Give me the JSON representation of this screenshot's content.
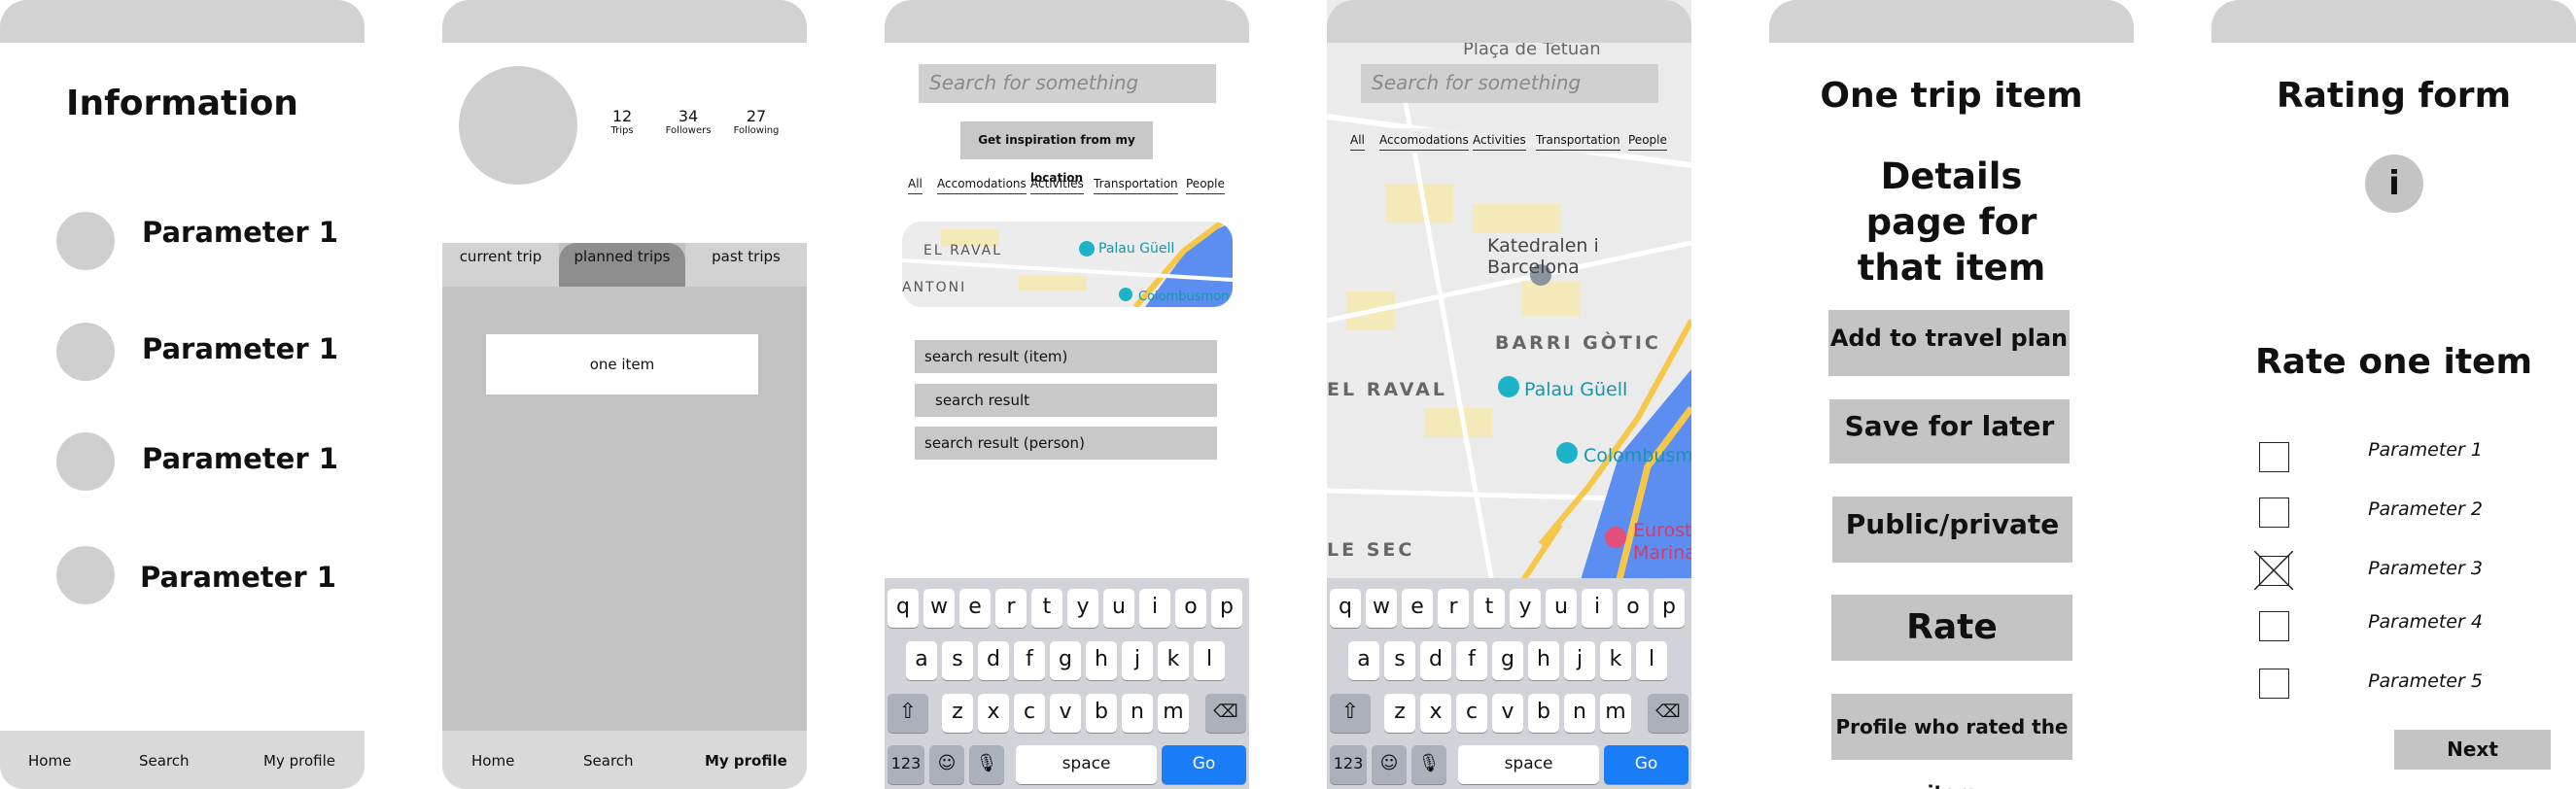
{
  "screen1": {
    "title": "Information",
    "params": [
      "Parameter 1",
      "Parameter 1",
      "Parameter 1",
      "Parameter 1"
    ],
    "nav": {
      "home": "Home",
      "search": "Search",
      "profile": "My profile"
    }
  },
  "screen2": {
    "stats": [
      {
        "value": "12",
        "label": "Trips"
      },
      {
        "value": "34",
        "label": "Followers"
      },
      {
        "value": "27",
        "label": "Following"
      }
    ],
    "tabs": [
      "current trip",
      "planned trips",
      "past trips"
    ],
    "item": "one item",
    "nav": {
      "home": "Home",
      "search": "Search",
      "profile": "My profile"
    }
  },
  "screen3": {
    "search_placeholder": "Search for something",
    "inspiration": "Get inspiration from my location",
    "filters": [
      "All",
      "Accomodations",
      "Activities",
      "Transportation",
      "People"
    ],
    "map_labels": {
      "district": "EL RAVAL",
      "place": "Palau Güell",
      "left": "ANTONI",
      "colombus": "Colombusmon"
    },
    "results": [
      "search result (item)",
      "search result",
      "search result (person)"
    ]
  },
  "screen4": {
    "search_placeholder": "Search for something",
    "filters": [
      "All",
      "Accomodations",
      "Activities",
      "Transportation",
      "People"
    ],
    "map_labels": {
      "plaza": "Plaça de Tetuan",
      "cathedral": "Katedralen i Barcelona",
      "gotic": "BARRI GÒTIC",
      "raval": "EL RAVAL",
      "palau": "Palau Güell",
      "colombus": "Colombusm",
      "sec": "LE SEC",
      "euro": "Eurost",
      "marina": "Marina"
    }
  },
  "keyboard": {
    "row1": [
      "q",
      "w",
      "e",
      "r",
      "t",
      "y",
      "u",
      "i",
      "o",
      "p"
    ],
    "row2": [
      "a",
      "s",
      "d",
      "f",
      "g",
      "h",
      "j",
      "k",
      "l"
    ],
    "row3": [
      "z",
      "x",
      "c",
      "v",
      "b",
      "n",
      "m"
    ],
    "num": "123",
    "space": "space",
    "go": "Go",
    "shift_icon": "shift-icon",
    "backspace_icon": "backspace-icon",
    "emoji_icon": "emoji-icon",
    "mic_icon": "microphone-icon"
  },
  "screen5": {
    "title1": "One trip item",
    "title2": "Details page for that item",
    "buttons": [
      "Add to travel plan",
      "Save for later",
      "Public/private",
      "Rate",
      "Profile who rated the item"
    ]
  },
  "screen6": {
    "title": "Rating form",
    "info": "i",
    "subtitle": "Rate one item",
    "params": [
      "Parameter 1",
      "Parameter 2",
      "Parameter 3",
      "Parameter 4",
      "Parameter 5"
    ],
    "checked": [
      false,
      false,
      true,
      false,
      false
    ],
    "next": "Next"
  },
  "colors": {
    "frame": "#d2d2d2",
    "panel": "#c2c2c2",
    "go": "#1a7cf6",
    "map_water": "#5b8ef0",
    "map_road": "#f5c74a"
  }
}
